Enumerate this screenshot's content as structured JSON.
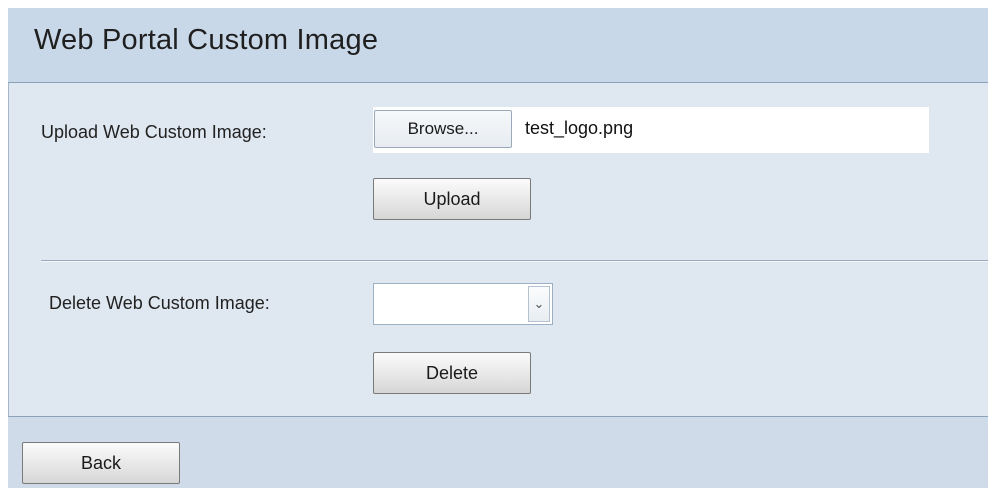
{
  "header": {
    "title": "Web Portal Custom Image"
  },
  "upload": {
    "label": "Upload Web Custom Image:",
    "browse_label": "Browse...",
    "file_name": "test_logo.png",
    "upload_label": "Upload"
  },
  "delete": {
    "label": "Delete Web Custom Image:",
    "selected_value": "",
    "delete_label": "Delete"
  },
  "footer": {
    "back_label": "Back"
  },
  "colors": {
    "title_bar": "#c9d8e8",
    "panel": "#dfe7f0"
  },
  "icons": {
    "select_arrow": "chevron-down-icon"
  }
}
